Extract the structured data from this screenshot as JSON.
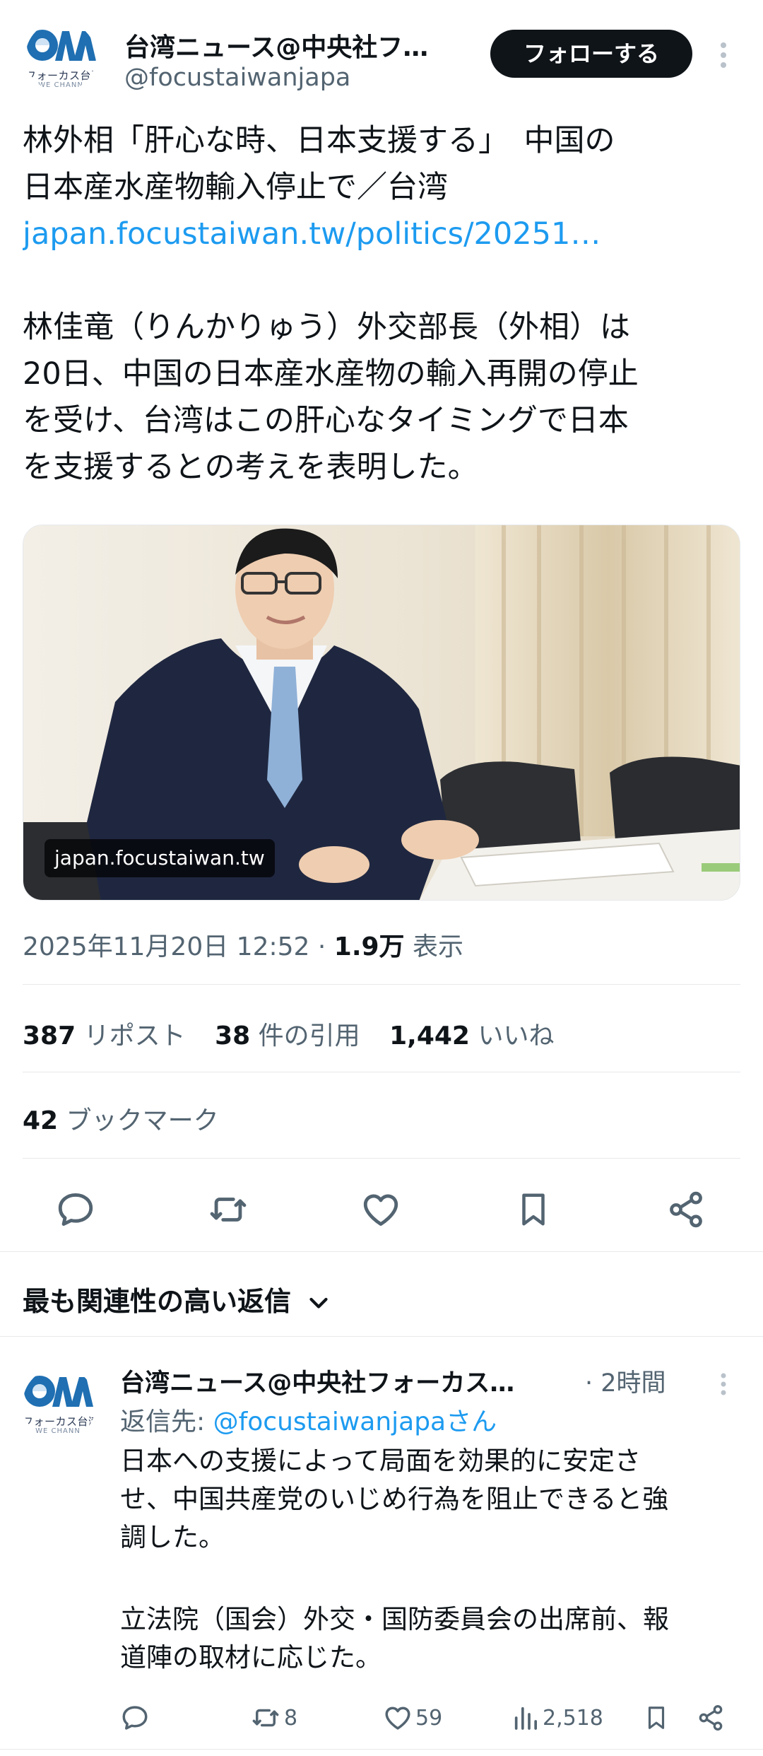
{
  "tweet": {
    "author_name": "台湾ニュース@中央社フ…",
    "author_handle": "@focustaiwanjapa",
    "follow_label": "フォローする",
    "avatar_sub": "フォーカス台湾",
    "avatar_sub2": "WE CHANN",
    "title_line1": "林外相「肝心な時、日本支援する」　中国の",
    "title_line2": "日本産水産物輸入停止で／台湾",
    "link": "japan.focustaiwan.tw/politics/20251…",
    "body_lines": [
      "林佳竜（りんかりゅう）外交部長（外相）は",
      "20日、中国の日本産水産物の輸入再開の停止",
      "を受け、台湾はこの肝心なタイミングで日本",
      "を支援するとの考えを表明した。"
    ],
    "media_caption": "japan.focustaiwan.tw",
    "timestamp": "2025年11月20日 12:52",
    "views_count": "1.9万",
    "views_label": "表示",
    "reposts_count": "387",
    "reposts_label": "リポスト",
    "quotes_count": "38",
    "quotes_label": "件の引用",
    "likes_count": "1,442",
    "likes_label": "いいね",
    "bookmarks_count": "42",
    "bookmarks_label": "ブックマーク"
  },
  "replies_section": {
    "title": "最も関連性の高い返信"
  },
  "reply": {
    "author_name": "台湾ニュース@中央社フォーカス…",
    "time": "· 2時間",
    "reply_to_prefix": "返信先: ",
    "reply_to_handle": "@focustaiwanjapaさん",
    "text_lines": [
      "日本への支援によって局面を効果的に安定さ",
      "せ、中国共産党のいじめ行為を阻止できると強",
      "調した。",
      "",
      "立法院（国会）外交・国防委員会の出席前、報",
      "道陣の取材に応じた。"
    ],
    "repost_count": "8",
    "like_count": "59",
    "view_count": "2,518"
  },
  "colors": {
    "accent": "#1d9bf0",
    "muted": "#536471",
    "text": "#0f1419",
    "logo_blue": "#1f6fb2"
  }
}
